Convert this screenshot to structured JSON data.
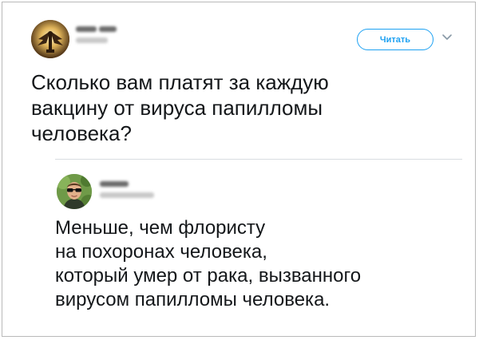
{
  "tweet": {
    "follow_label": "Читать",
    "text": "Сколько вам платят за каждую\nвакцину от вируса папилломы\nчеловека?"
  },
  "reply": {
    "text": "Меньше, чем флористу\nна похоронах человека,\nкоторый умер от рака, вызванного\nвирусом папилломы человека."
  },
  "colors": {
    "accent": "#1da1f2",
    "text": "#14171a",
    "divider": "#d8dde1"
  },
  "icons": {
    "more_menu": "chevron-down-icon"
  }
}
